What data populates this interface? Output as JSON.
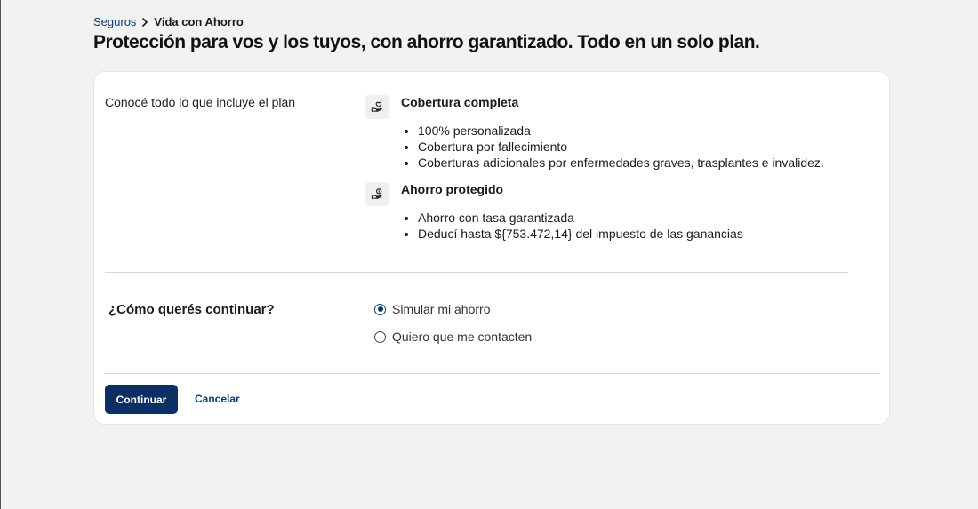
{
  "breadcrumb": {
    "parent": "Seguros",
    "current": "Vida con Ahorro"
  },
  "title": "Protección para vos y los tuyos, con ahorro garantizado. Todo en un solo plan.",
  "includes_label": "Conocé todo lo que incluye el plan",
  "features": [
    {
      "icon": "heart-hand-icon",
      "title": "Cobertura completa",
      "items": [
        "100% personalizada",
        "Cobertura por fallecimiento",
        "Coberturas adicionales por enfermedades graves, trasplantes e invalidez."
      ]
    },
    {
      "icon": "money-hand-icon",
      "title": "Ahorro protegido",
      "items": [
        "Ahorro con tasa garantizada",
        "Deducí hasta ${753.472,14} del impuesto de las ganancias"
      ]
    }
  ],
  "question": "¿Cómo querés continuar?",
  "options": [
    {
      "label": "Simular mi ahorro",
      "selected": true
    },
    {
      "label": "Quiero que me contacten",
      "selected": false
    }
  ],
  "actions": {
    "continue_label": "Continuar",
    "cancel_label": "Cancelar"
  },
  "colors": {
    "primary": "#0b2f63",
    "link": "#0b3a6e",
    "background": "#f2f2f2",
    "card": "#ffffff"
  }
}
